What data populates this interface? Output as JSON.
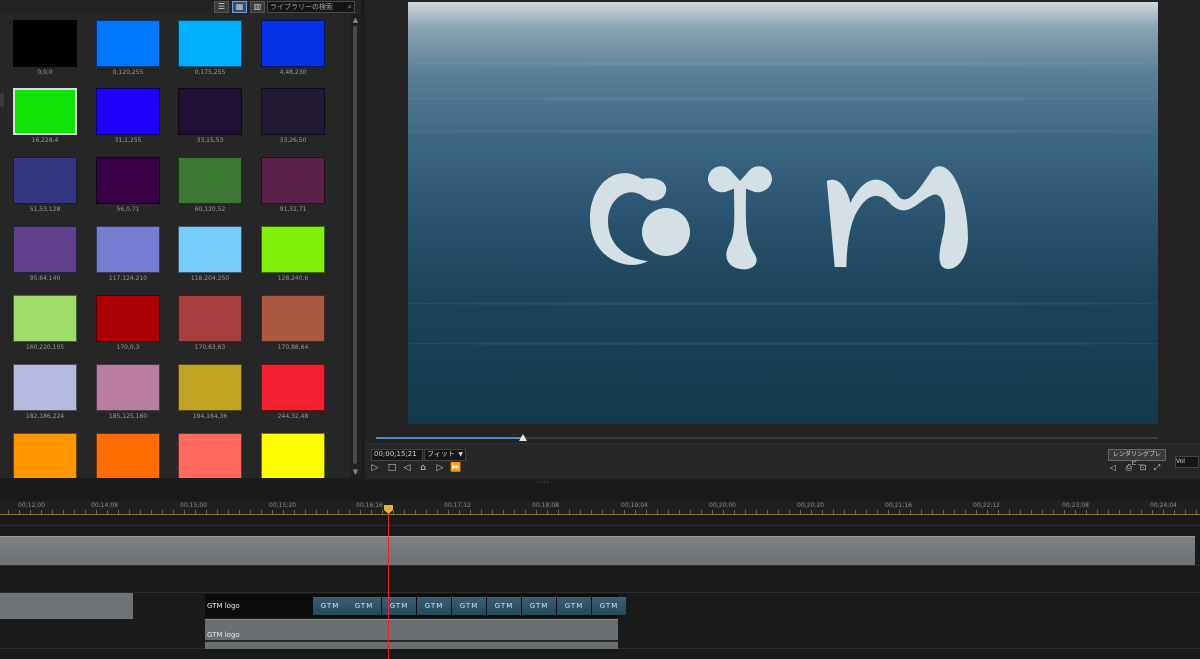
{
  "library": {
    "search_placeholder": "ライブラリーの検索",
    "view_buttons": [
      "list-view",
      "grid-view",
      "details-view"
    ],
    "swatches": [
      {
        "label": "0,0,0",
        "color": "#000000"
      },
      {
        "label": "0,120,255",
        "color": "#0078ff"
      },
      {
        "label": "0,175,255",
        "color": "#00afff"
      },
      {
        "label": "4,48,230",
        "color": "#0430e6"
      },
      {
        "label": "16,228,4",
        "color": "#10e404"
      },
      {
        "label": "31,1,255",
        "color": "#1f01ff"
      },
      {
        "label": "33,15,53",
        "color": "#210f35"
      },
      {
        "label": "33,26,50",
        "color": "#211a32"
      },
      {
        "label": "51,53,128",
        "color": "#333580"
      },
      {
        "label": "56,0,71",
        "color": "#380047"
      },
      {
        "label": "60,120,52",
        "color": "#3c7834"
      },
      {
        "label": "91,32,71",
        "color": "#5b2047"
      },
      {
        "label": "95,64,140",
        "color": "#5f408c"
      },
      {
        "label": "117,124,210",
        "color": "#757cd2"
      },
      {
        "label": "118,204,250",
        "color": "#76ccfa"
      },
      {
        "label": "128,240,6",
        "color": "#80f006"
      },
      {
        "label": "160,220,105",
        "color": "#a0dc69"
      },
      {
        "label": "170,0,3",
        "color": "#aa0003"
      },
      {
        "label": "170,63,63",
        "color": "#aa3f3f"
      },
      {
        "label": "170,88,64",
        "color": "#aa5840"
      },
      {
        "label": "182,186,224",
        "color": "#b6bae0"
      },
      {
        "label": "185,125,160",
        "color": "#b97da0"
      },
      {
        "label": "194,164,36",
        "color": "#c2a424"
      },
      {
        "label": "244,32,48",
        "color": "#f42030"
      },
      {
        "label": "",
        "color": "#ff9600"
      },
      {
        "label": "",
        "color": "#ff6c00"
      },
      {
        "label": "",
        "color": "#ff6a5c"
      },
      {
        "label": "",
        "color": "#ffff00"
      }
    ]
  },
  "preview": {
    "logo_text": "GTM",
    "progress": 0.19
  },
  "controls": {
    "timecode": "00;00;15;21",
    "quality": "フィット",
    "render_button": "レンダリングプレビ...",
    "right_select": "Vol"
  },
  "timeline": {
    "ruler_labels": [
      "00;12;00",
      "00;14;08",
      "00;15;00",
      "00;15;20",
      "00;16;16",
      "00;17;12",
      "00;18;08",
      "00;19;04",
      "00;20;00",
      "00;20;20",
      "00;21;16",
      "00;22;12",
      "00;23;08",
      "00;24;04"
    ],
    "video_clip_label": "GTM logo",
    "audio_clip_label": "GTM logo",
    "thumb_text": "GTM"
  }
}
